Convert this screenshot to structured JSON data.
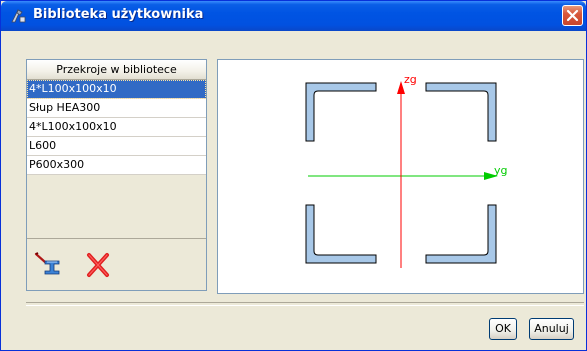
{
  "window": {
    "title": "Biblioteka użytkownika",
    "icons": {
      "title": "app-icon",
      "close": "close-icon"
    }
  },
  "library": {
    "header": "Przekroje w bibliotece",
    "items": [
      {
        "label": "4*L100x100x10",
        "selected": true
      },
      {
        "label": "Słup HEA300",
        "selected": false
      },
      {
        "label": "4*L100x100x10",
        "selected": false
      },
      {
        "label": "L600",
        "selected": false
      },
      {
        "label": "P600x300",
        "selected": false
      }
    ],
    "toolbar": {
      "add_icon": "add-section-icon",
      "delete_icon": "delete-icon"
    }
  },
  "preview": {
    "axis_z_label": "zg",
    "axis_y_label": "yg",
    "colors": {
      "z_axis": "#ff0000",
      "y_axis": "#00cc00",
      "section_fill": "#a8c8e8",
      "section_stroke": "#000000"
    }
  },
  "buttons": {
    "ok": "OK",
    "cancel": "Anuluj"
  }
}
